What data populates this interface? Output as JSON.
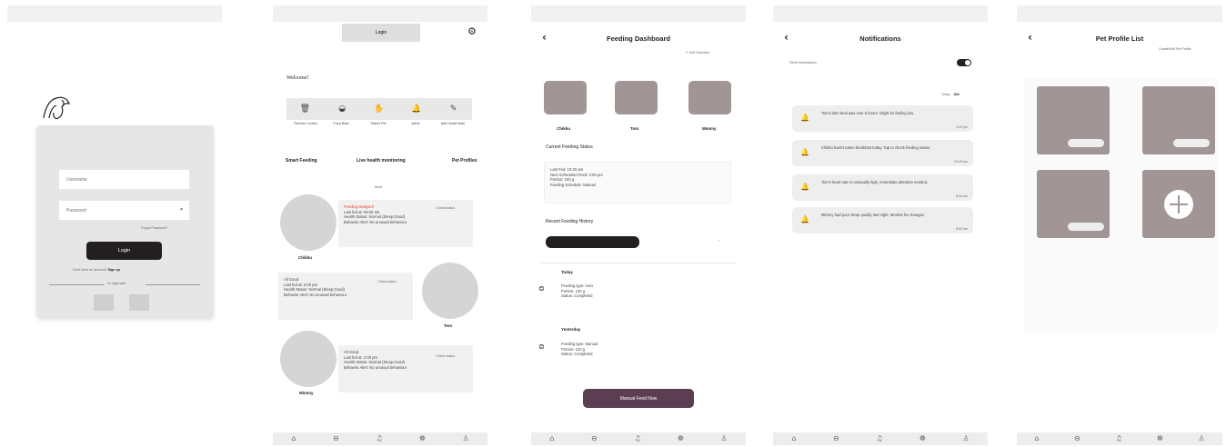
{
  "login": {
    "username_placeholder": "Username",
    "password_placeholder": "Password",
    "forgot_password": "Forgot Password?",
    "login_button": "Login",
    "no_account": "Don't have an account?",
    "sign_up": "Sign up",
    "or_login_with": "Or login with"
  },
  "home": {
    "top_button": "Login",
    "welcome": "Welcome!",
    "features": [
      {
        "icon": "pet-bowl-icon",
        "label": "Remote Control"
      },
      {
        "icon": "food-bowl-icon",
        "label": "Food Bowl"
      },
      {
        "icon": "switch-pet-icon",
        "label": "Switch Pet"
      },
      {
        "icon": "bell-icon",
        "label": "Alerts"
      },
      {
        "icon": "add-health-icon",
        "label": "Add Health Note"
      }
    ],
    "nav": [
      "Smart Feeding",
      "Live health monitoring",
      "Pet Profiles"
    ],
    "more": "More",
    "pets": [
      {
        "name": "Chikku",
        "check": "Check status",
        "alert": "Feeding Delayed!",
        "lines": [
          "Last fed at: 09:20 am",
          "Health Status: Normal (Sleep,Good)",
          "Behavior Alert: No unusual behaviour"
        ]
      },
      {
        "name": "Tom",
        "check": "Check status",
        "alert": "",
        "lines": [
          "All Good",
          "Last fed at: 2:00 pm",
          "Health Status: Normal (Sleep,Good)",
          "Behavior Alert: No unusual behaviour"
        ]
      },
      {
        "name": "Mimmy",
        "check": "Check status",
        "alert": "",
        "lines": [
          "All Good",
          "Last fed at: 2:00 pm",
          "Health Status: Normal (Sleep,Good)",
          "Behavior Alert: No unusual behaviour"
        ]
      }
    ]
  },
  "dashboard": {
    "title": "Feeding Dashboard",
    "edit_schedule": "Edit Schedule",
    "pets": [
      "Chikku",
      "Tom",
      "Mimmy"
    ],
    "current_status_label": "Current Feeding Status",
    "status_lines": [
      "Last Fed: 10:20 am",
      "Next Scheduled Feed: 2:00 pm",
      "Portion: 100 g",
      "Feeding Schedule: Manual"
    ],
    "history_label": "Recent Feeding History",
    "today_label": "Today",
    "today_lines": [
      "Feeding type: Auto",
      "Portion: 100 g",
      "Status: Completed"
    ],
    "yesterday_label": "Yesterday",
    "yesterday_lines": [
      "Feeding type: Manual",
      "Portion: 120 g",
      "Status: Completed"
    ],
    "manual_feed": "Manual Feed Now"
  },
  "notifications": {
    "title": "Notifications",
    "direct_label": "Direct Notifications",
    "filter_today": "Today",
    "filter_old": "Old",
    "items": [
      {
        "text": "Tom's last meal was over 6 hours. Might be feeling low.",
        "time": "2:00 pm"
      },
      {
        "text": "Chikku hasn't eaten breakfast today. Tap to check feeding status.",
        "time": "10:45 am"
      },
      {
        "text": "Tom's heart rate is unusually high, immediate attention needed.",
        "time": "8:30 am"
      },
      {
        "text": "Mimmy had poor sleep quality last night. Monitor for changes.",
        "time": "8:00 am"
      }
    ]
  },
  "profiles": {
    "title": "Pet Profile List",
    "subtitle": "Create/Edit Pet Profile"
  },
  "colors": {
    "accent_dark": "#231f20",
    "mauve": "#a29596",
    "plum": "#5c3e52",
    "alert_red": "#e03a3a"
  }
}
